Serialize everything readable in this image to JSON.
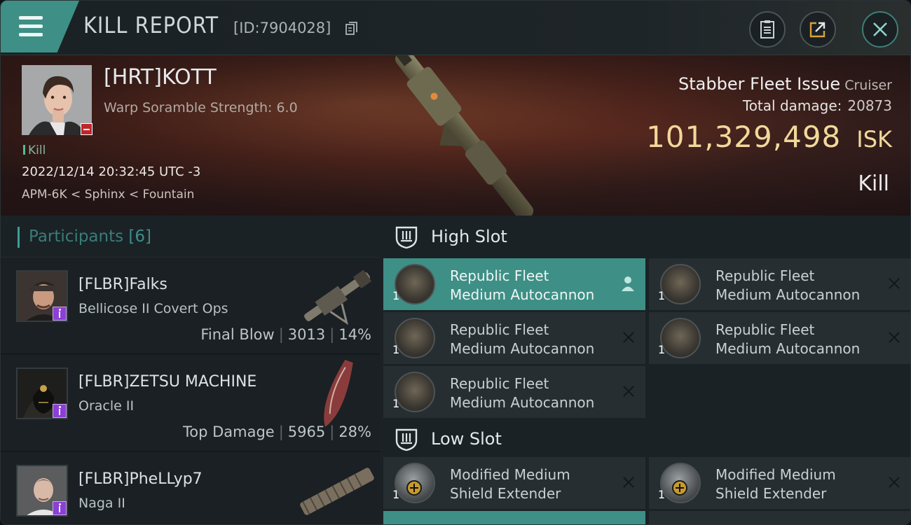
{
  "header": {
    "title": "KILL REPORT",
    "report_id": "[ID:7904028]",
    "icons": [
      "menu-icon",
      "copy-icon",
      "clipboard-icon",
      "share-icon",
      "close-icon"
    ]
  },
  "victim": {
    "name": "[HRT]KOTT",
    "scramble": "Warp Soramble Strength: 6.0",
    "tag": "Kill",
    "date": "2022/12/14 20:32:45 UTC -3",
    "location": "APM-6K < Sphinx < Fountain",
    "ship": "Stabber Fleet Issue",
    "ship_class": "Cruiser",
    "damage_label": "Total damage:",
    "damage_value": "20873",
    "isk_value": "101,329,498",
    "isk_unit": "ISK",
    "status": "Kill"
  },
  "participants": {
    "title": "Participants",
    "count": "[6]",
    "rows": [
      {
        "name": "[FLBR]Falks",
        "ship": "Bellicose II Covert Ops",
        "label": "Final Blow",
        "damage": "3013",
        "percent": "14%"
      },
      {
        "name": "[FLBR]ZETSU MACHINE",
        "ship": "Oracle II",
        "label": "Top Damage",
        "damage": "5965",
        "percent": "28%"
      },
      {
        "name": "[FLBR]PheLLyp7",
        "ship": "Naga II",
        "label": "",
        "damage": "",
        "percent": ""
      }
    ]
  },
  "slots": {
    "high": {
      "title": "High Slot",
      "modules": [
        {
          "qty": "1",
          "line1": "Republic Fleet",
          "line2": "Medium Autocannon"
        },
        {
          "qty": "1",
          "line1": "Republic Fleet",
          "line2": "Medium Autocannon"
        },
        {
          "qty": "1",
          "line1": "Republic Fleet",
          "line2": "Medium Autocannon"
        },
        {
          "qty": "1",
          "line1": "Republic Fleet",
          "line2": "Medium Autocannon"
        },
        {
          "qty": "1",
          "line1": "Republic Fleet",
          "line2": "Medium Autocannon"
        }
      ]
    },
    "low": {
      "title": "Low Slot",
      "modules": [
        {
          "qty": "1",
          "line1": "Modified Medium",
          "line2": "Shield Extender"
        },
        {
          "qty": "1",
          "line1": "Modified Medium",
          "line2": "Shield Extender"
        }
      ]
    }
  },
  "colors": {
    "accent": "#3e8f86",
    "isk": "#f2d89a",
    "banner": "#5c2a1f",
    "badge": "#8c3fd6"
  }
}
